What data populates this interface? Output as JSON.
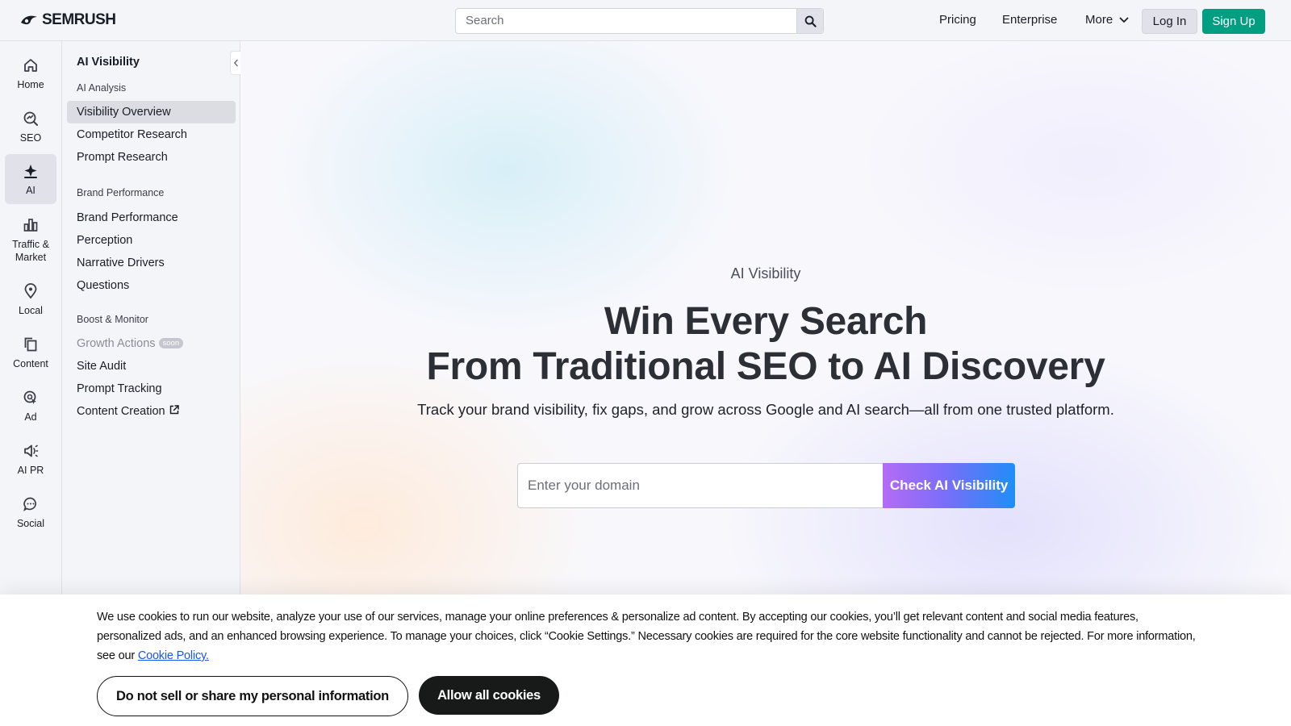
{
  "header": {
    "logo_text": "SEMRUSH",
    "search_placeholder": "Search",
    "nav": {
      "pricing": "Pricing",
      "enterprise": "Enterprise",
      "more": "More"
    },
    "login": "Log In",
    "signup": "Sign Up"
  },
  "rail": {
    "items": [
      {
        "label": "Home",
        "icon": "home-icon"
      },
      {
        "label": "SEO",
        "icon": "seo-icon"
      },
      {
        "label": "AI",
        "icon": "ai-icon"
      },
      {
        "label": "Traffic & Market",
        "icon": "bar-chart-icon"
      },
      {
        "label": "Local",
        "icon": "location-pin-icon"
      },
      {
        "label": "Content",
        "icon": "content-icon"
      },
      {
        "label": "Ad",
        "icon": "ad-icon"
      },
      {
        "label": "AI PR",
        "icon": "megaphone-icon"
      },
      {
        "label": "Social",
        "icon": "chat-bubble-icon"
      },
      {
        "label": "",
        "icon": "report-icon"
      }
    ]
  },
  "sidebar": {
    "title": "AI Visibility",
    "groups": {
      "ai_analysis": "AI Analysis",
      "brand_performance": "Brand Performance",
      "boost_monitor": "Boost & Monitor"
    },
    "items": {
      "visibility_overview": "Visibility Overview",
      "competitor_research": "Competitor Research",
      "prompt_research": "Prompt Research",
      "brand_performance": "Brand Performance",
      "perception": "Perception",
      "narrative_drivers": "Narrative Drivers",
      "questions": "Questions",
      "growth_actions": "Growth Actions",
      "soon_badge": "soon",
      "site_audit": "Site Audit",
      "prompt_tracking": "Prompt Tracking",
      "content_creation": "Content Creation"
    }
  },
  "hero": {
    "eyebrow": "AI Visibility",
    "headline_line1": "Win Every Search",
    "headline_line2": "From Traditional SEO to AI Discovery",
    "subline": "Track your brand visibility, fix gaps, and grow across Google and AI search—all from one trusted platform.",
    "domain_placeholder": "Enter your domain",
    "cta": "Check AI Visibility"
  },
  "cookie": {
    "text": "We use cookies to run our website, analyze your use of our services, manage your online preferences & personalize ad content. By accepting our cookies, you’ll get relevant content and social media features, personalized ads, and an enhanced browsing experience. To manage your choices, click “Cookie Settings.” Necessary cookies are required for the core website functionality and cannot be rejected. For more information, see our",
    "link": "Cookie Policy.",
    "dns_button": "Do not sell or share my personal information",
    "allow_button": "Allow all cookies"
  },
  "colors": {
    "brand_green": "#009f81",
    "cta_gradient_start": "#b46cf5",
    "cta_gradient_end": "#1f8ef7",
    "link_blue": "#1a55f5"
  }
}
